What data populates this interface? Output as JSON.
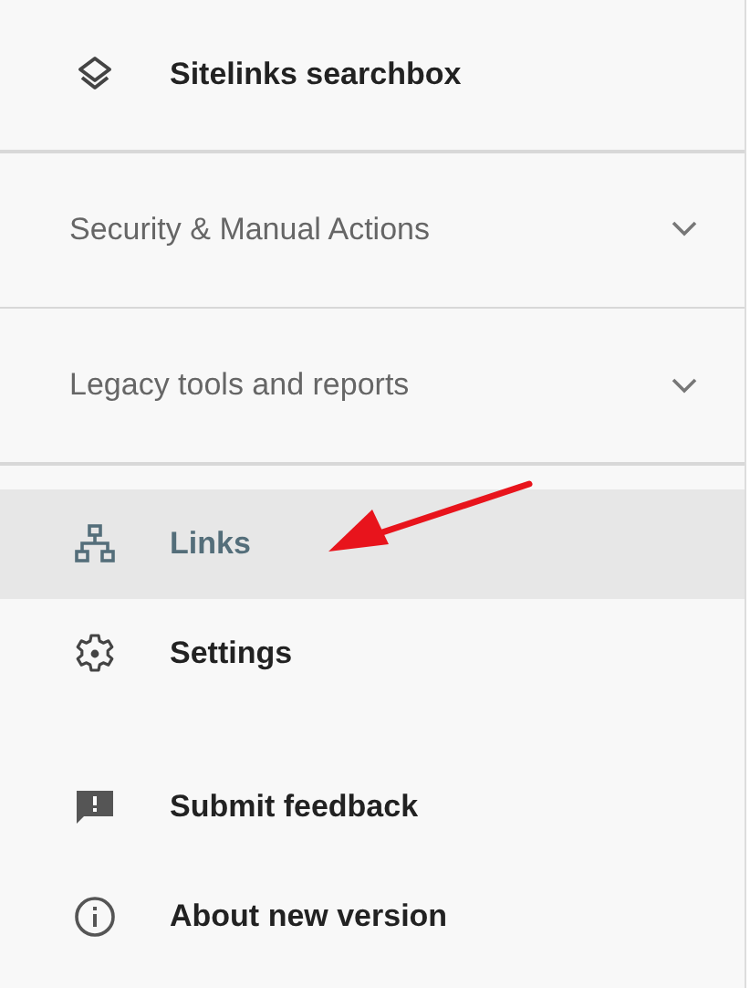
{
  "top_item": {
    "label": "Sitelinks searchbox"
  },
  "sections": [
    {
      "label": "Security & Manual Actions",
      "expanded": false
    },
    {
      "label": "Legacy tools and reports",
      "expanded": false
    }
  ],
  "nav": [
    {
      "label": "Links",
      "selected": true
    },
    {
      "label": "Settings",
      "selected": false
    }
  ],
  "footer": [
    {
      "label": "Submit feedback"
    },
    {
      "label": "About new version"
    }
  ]
}
